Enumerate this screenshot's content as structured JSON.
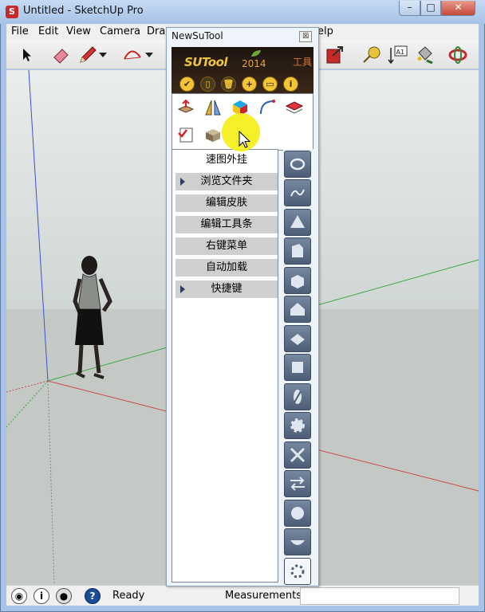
{
  "window": {
    "title": "Untitled - SketchUp Pro",
    "icon": "sketchup-logo-icon",
    "controls": {
      "minimize": "–",
      "maximize": "□",
      "close": "✕"
    }
  },
  "menubar": [
    "File",
    "Edit",
    "View",
    "Camera",
    "Dra",
    "elp"
  ],
  "toolbar": [
    "select-arrow-icon",
    "eraser-icon",
    "pencil-line-icon",
    "arc-icon",
    "export-icon",
    "tape-measure-icon",
    "text-label-icon",
    "paint-bucket-icon",
    "orbit-icon"
  ],
  "toolbar_labels": {
    "text_tool": "A1"
  },
  "panel": {
    "title": "NewSuTool",
    "close": "☒",
    "brand": "SUTool",
    "year": "2014",
    "tag": "工具",
    "action_buttons": [
      "✔",
      "▯",
      "🗑",
      "+",
      "▭",
      "i"
    ],
    "tools": [
      "push-pull-icon",
      "mirror-icon",
      "material-cube-icon",
      "curve-icon",
      "layers-icon",
      "checklist-icon",
      "box-icon"
    ],
    "menu": [
      {
        "label": "速图外挂",
        "arrow": false
      },
      {
        "label": "浏览文件夹",
        "arrow": true
      },
      {
        "label": "编辑皮肤",
        "arrow": false
      },
      {
        "label": "编辑工具条",
        "arrow": false
      },
      {
        "label": "右键菜单",
        "arrow": false
      },
      {
        "label": "自动加载",
        "arrow": false
      },
      {
        "label": "快捷键",
        "arrow": true
      }
    ],
    "side_buttons": [
      "orbit-ring-icon",
      "wave-icon",
      "pyramid-icon",
      "prism-icon",
      "box-3d-icon",
      "house-icon",
      "flatten-icon",
      "layers-3d-icon",
      "slice-icon",
      "gear-icon",
      "tools-icon",
      "arrows-icon",
      "sphere-icon",
      "dish-icon",
      "settings-gear-icon"
    ]
  },
  "statusbar": {
    "icons": [
      "geo-location-icon",
      "info-icon",
      "user-icon",
      "help-icon"
    ],
    "ready": "Ready",
    "measurements_label": "Measurements",
    "measurements_value": ""
  },
  "colors": {
    "axis_red": "#c84b4b",
    "axis_green": "#3da845",
    "axis_blue": "#3b4fd6",
    "highlight": "#f4ef1e",
    "brand_gold": "#f1c43e"
  }
}
